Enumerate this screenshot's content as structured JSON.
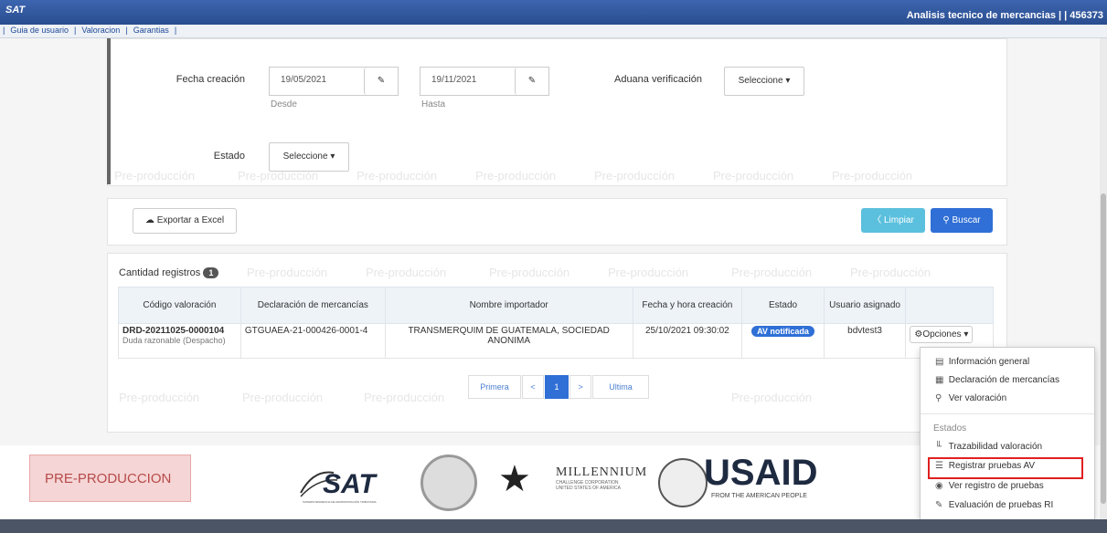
{
  "window": {
    "app_logo": "SAT",
    "title_right": "Analisis tecnico de mercancias | | 456373"
  },
  "menu": {
    "items": [
      "Guia de usuario",
      "Valoracion",
      "Garantias"
    ]
  },
  "filters": {
    "fecha_label": "Fecha creación",
    "desde_value": "19/05/2021",
    "desde_hint": "Desde",
    "hasta_value": "19/11/2021",
    "hasta_hint": "Hasta",
    "aduana_label": "Aduana verificación",
    "aduana_select": "Seleccione",
    "estado_label": "Estado",
    "estado_select": "Seleccione"
  },
  "actions": {
    "export_label": "Exportar a Excel",
    "limpiar_label": "Limpiar",
    "buscar_label": "Buscar"
  },
  "results": {
    "count_label": "Cantidad registros",
    "count": "1",
    "headers": [
      "Código valoración",
      "Declaración de mercancías",
      "Nombre importador",
      "Fecha y hora creación",
      "Estado",
      "Usuario asignado",
      ""
    ],
    "row": {
      "codigo": "DRD-20211025-0000104",
      "codigo_sub": "Duda razonable (Despacho)",
      "declaracion": "GTGUAEA-21-000426-0001-4",
      "importador": "TRANSMERQUIM DE GUATEMALA, SOCIEDAD ANONIMA",
      "fecha": "25/10/2021 09:30:02",
      "estado": "AV notificada",
      "usuario": "bdvtest3",
      "opciones": "Opciones"
    }
  },
  "pagination": {
    "first": "Primera",
    "prev": "<",
    "current": "1",
    "next": ">",
    "last": "Ultima"
  },
  "dropdown_menu": {
    "items": [
      "Información general",
      "Declaración de mercancías",
      "Ver valoración"
    ],
    "section_label": "Estados",
    "state_items": [
      "Trazabilidad valoración",
      "Registrar pruebas AV",
      "Ver registro de pruebas",
      "Evaluación de pruebas RI"
    ],
    "highlight_color": "#e02020"
  },
  "watermark_text": "Pre-producción",
  "footer": {
    "env_label": "PRE-PRODUCCION",
    "logos": {
      "sat": "SAT",
      "sat_sub": "SUPERINTENDENCIA DE ADMINISTRACIÓN TRIBUTARIA",
      "mcc_title": "MILLENNIUM",
      "mcc_sub1": "CHALLENGE CORPORATION",
      "mcc_sub2": "UNITED STATES OF AMERICA",
      "usaid": "USAID",
      "usaid_sub": "FROM THE AMERICAN PEOPLE"
    }
  },
  "colors": {
    "title_bg": "#2f58a3",
    "primary": "#2f6fd6",
    "limpiar": "#5bc0de",
    "badge": "#2f6fd6"
  }
}
